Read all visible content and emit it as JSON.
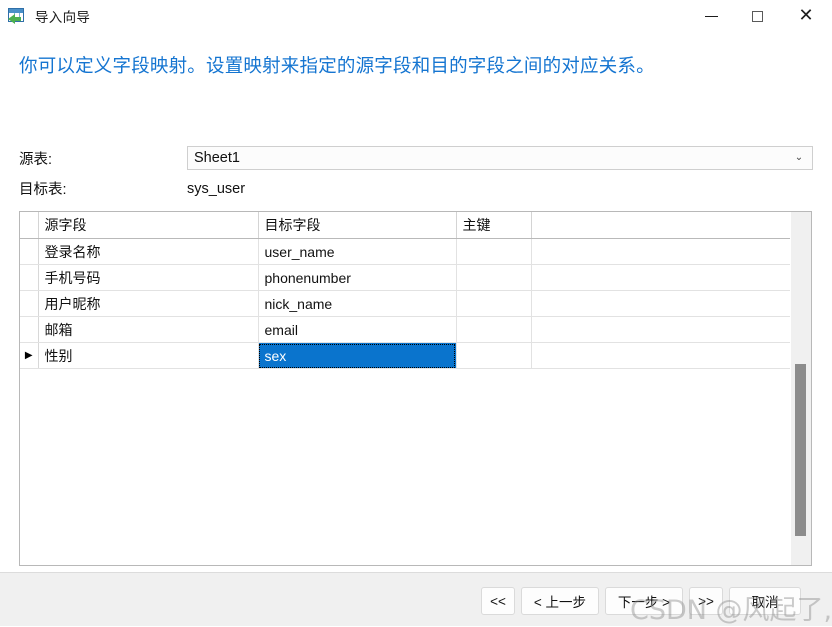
{
  "window": {
    "title": "导入向导",
    "icon": "import-wizard-icon",
    "controls": {
      "minimize": "—",
      "maximize": "□",
      "close": "✕"
    }
  },
  "instruction": "你可以定义字段映射。设置映射来指定的源字段和目的字段之间的对应关系。",
  "form": {
    "source_table": {
      "label": "源表:",
      "value": "Sheet1",
      "arrow": "⌄"
    },
    "target_table": {
      "label": "目标表:",
      "value": "sys_user"
    }
  },
  "grid": {
    "columns": [
      "源字段",
      "目标字段",
      "主键",
      ""
    ],
    "rows": [
      {
        "indicator": "",
        "source_field": "登录名称",
        "target_field": "user_name",
        "primary_key": "",
        "selected": false
      },
      {
        "indicator": "",
        "source_field": "手机号码",
        "target_field": "phonenumber",
        "primary_key": "",
        "selected": false
      },
      {
        "indicator": "",
        "source_field": "用户昵称",
        "target_field": "nick_name",
        "primary_key": "",
        "selected": false
      },
      {
        "indicator": "",
        "source_field": "邮箱",
        "target_field": "email",
        "primary_key": "",
        "selected": false
      },
      {
        "indicator": "▶",
        "source_field": "性别",
        "target_field": "sex",
        "primary_key": "",
        "selected": true
      }
    ],
    "selection_color": "#0a74cd",
    "scrollbar": {
      "name": "vertical-scrollbar"
    }
  },
  "footer": {
    "buttons": [
      {
        "name": "first-button",
        "label": "<<",
        "style": "nav"
      },
      {
        "name": "previous-button",
        "label": "< 上一步",
        "style": "mid"
      },
      {
        "name": "next-button",
        "label": "下一步 >",
        "style": "mid"
      },
      {
        "name": "last-button",
        "label": ">>",
        "style": "nav"
      },
      {
        "name": "cancel-button",
        "label": "取消",
        "style": "cancel"
      }
    ]
  },
  "watermark": "CSDN @风起了,嗯"
}
